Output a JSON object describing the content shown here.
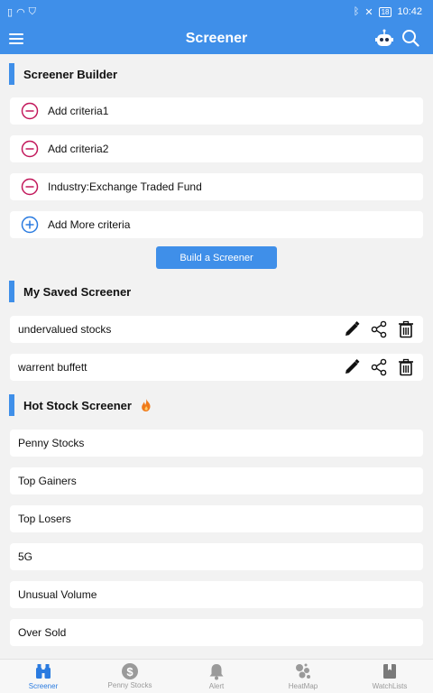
{
  "status": {
    "time": "10:42",
    "battery": "18"
  },
  "app": {
    "title": "Screener"
  },
  "sections": {
    "builder": "Screener Builder",
    "saved": "My Saved Screener",
    "hot": "Hot Stock Screener"
  },
  "criteria": [
    "Add criteria1",
    "Add criteria2",
    "Industry:Exchange Traded Fund"
  ],
  "add_more": "Add More criteria",
  "build_button": "Build a Screener",
  "saved": [
    "undervalued stocks",
    "warrent buffett"
  ],
  "hot": [
    "Penny Stocks",
    "Top Gainers",
    "Top Losers",
    "5G",
    "Unusual Volume",
    "Over Sold"
  ],
  "tabs": [
    "Screener",
    "Penny Stocks",
    "Alert",
    "HeatMap",
    "WatchLists"
  ],
  "colors": {
    "accent": "#3f8fe9",
    "remove": "#c2185b",
    "add": "#2a7be0",
    "fire": "#f07a1a"
  },
  "icons": {
    "remove": "minus-circle-icon",
    "add": "plus-circle-icon",
    "edit": "pencil-icon",
    "share": "share-icon",
    "delete": "trash-icon"
  }
}
